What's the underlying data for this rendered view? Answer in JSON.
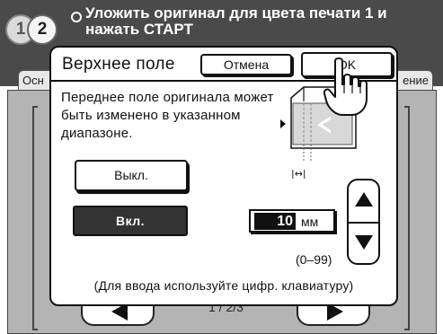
{
  "header": {
    "badge_1": "1",
    "badge_2": "2",
    "message": "Уложить оригинал для цвета печати 1 и нажать СТАРТ"
  },
  "background": {
    "tab_left_label": "Осн",
    "tab_right_label": "ение",
    "page_indicator": "1 / 2/3"
  },
  "dialog": {
    "title": "Верхнее поле",
    "cancel_label": "Отмена",
    "ok_label": "OK",
    "description": "Переднее поле оригинала может быть изменено в указанном диапазоне.",
    "off_label": "Выкл.",
    "on_label": "Вкл.",
    "selected_option": "Вкл.",
    "margin_value": "10",
    "margin_unit": "мм",
    "range": "(0–99)",
    "hint": "(Для ввода используйте цифр. клавиатуру)",
    "diagram_arrow_label": "|↔|"
  },
  "icons": {
    "stepper_up": "triangle-up-icon",
    "stepper_down": "triangle-down-icon",
    "pointer": "hand-pointer-icon",
    "diagram": "margin-diagram-icon"
  },
  "colors": {
    "header_bg": "#4a4a4a",
    "panel_bg": "#b4b4b4",
    "selected_bg": "#333333",
    "text": "#111111"
  }
}
